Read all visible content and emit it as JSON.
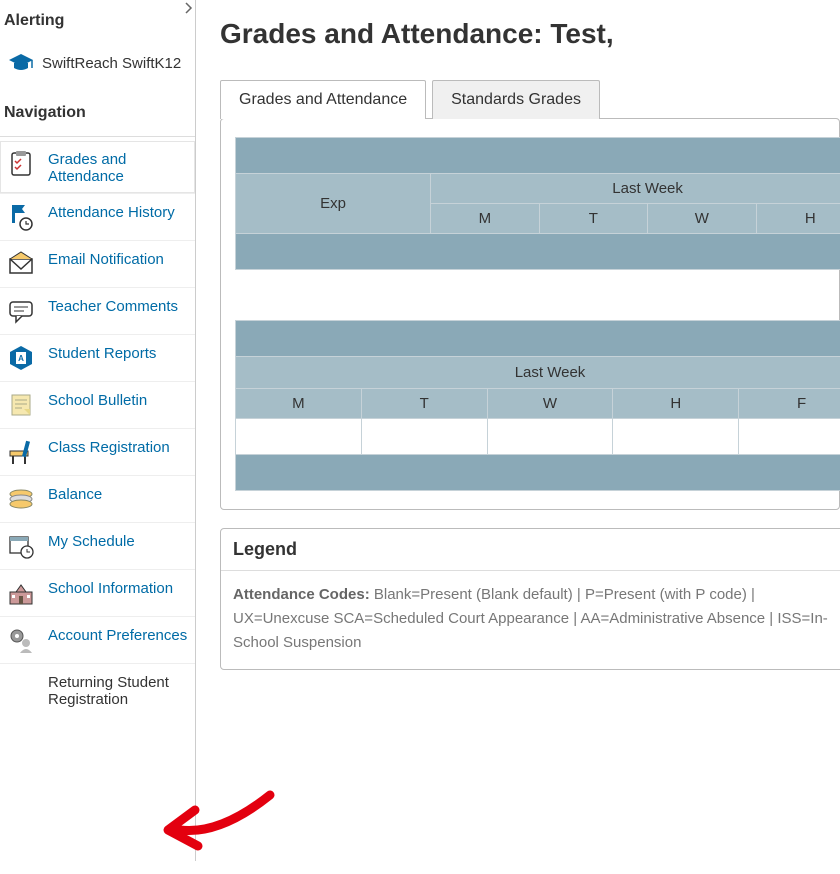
{
  "sidebar": {
    "alerting_header": "Alerting",
    "alert_item": {
      "label": "SwiftReach SwiftK12"
    },
    "nav_header": "Navigation",
    "items": [
      {
        "label": "Grades and Attendance",
        "icon": "clipboard-check"
      },
      {
        "label": "Attendance History",
        "icon": "flag-clock"
      },
      {
        "label": "Email Notification",
        "icon": "envelope"
      },
      {
        "label": "Teacher Comments",
        "icon": "speech-bubble"
      },
      {
        "label": "Student Reports",
        "icon": "hex-doc"
      },
      {
        "label": "School Bulletin",
        "icon": "note"
      },
      {
        "label": "Class Registration",
        "icon": "desk-pencil"
      },
      {
        "label": "Balance",
        "icon": "coins"
      },
      {
        "label": "My Schedule",
        "icon": "calendar-clock"
      },
      {
        "label": "School Information",
        "icon": "school-building"
      },
      {
        "label": "Account Preferences",
        "icon": "gear-people"
      },
      {
        "label": "Returning Student Registration",
        "icon": ""
      }
    ]
  },
  "page": {
    "title": "Grades and Attendance: Test,"
  },
  "tabs": [
    {
      "label": "Grades and Attendance",
      "active": true
    },
    {
      "label": "Standards Grades",
      "active": false
    }
  ],
  "table1": {
    "exp": "Exp",
    "group": "Last Week",
    "days": [
      "M",
      "T",
      "W",
      "H"
    ]
  },
  "table2": {
    "group": "Last Week",
    "days": [
      "M",
      "T",
      "W",
      "H",
      "F"
    ]
  },
  "legend": {
    "title": "Legend",
    "label": "Attendance Codes:",
    "text": "Blank=Present (Blank default) | P=Present (with P code) | UX=Unexcuse SCA=Scheduled Court Appearance | AA=Administrative Absence | ISS=In-School Suspension"
  }
}
